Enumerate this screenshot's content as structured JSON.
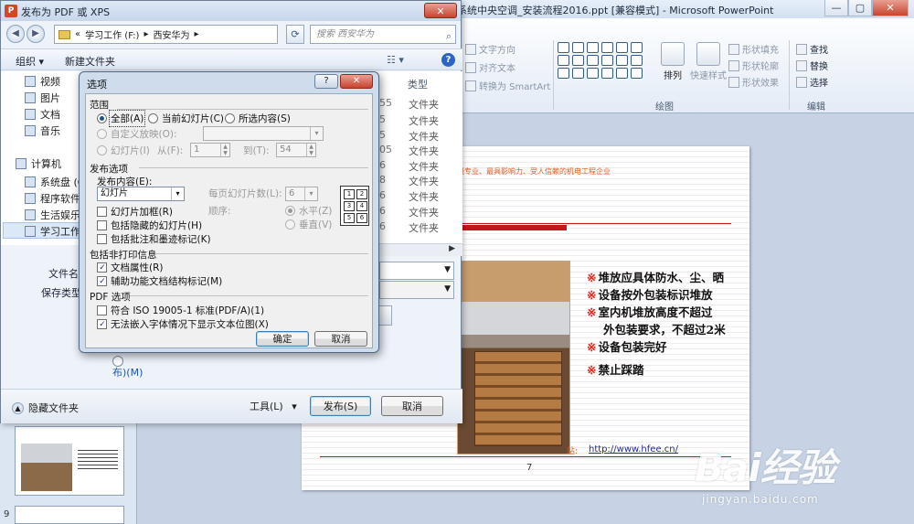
{
  "powerpoint": {
    "window_title": "系统中央空调_安装流程2016.ppt [兼容模式] - Microsoft PowerPoint",
    "ribbon": {
      "arrange_group": {
        "text_direction": "文字方向",
        "align_text": "对齐文本",
        "convert_smartart": "转换为 SmartArt"
      },
      "drawing_group": {
        "label": "绘图",
        "arrange": "排列",
        "quick_styles": "快速样式",
        "shape_fill": "形状填充",
        "shape_outline": "形状轮廓",
        "shape_effects": "形状效果"
      },
      "editing_group": {
        "label": "编辑",
        "find": "查找",
        "replace": "替换",
        "select": "选择"
      }
    },
    "thumbnails": [
      {
        "number": "9"
      }
    ],
    "slide": {
      "tagline": "最专业、最具影响力、受人信赖的机电工程企业",
      "bullets": [
        "堆放应具体防水、尘、晒",
        "设备按外包装标识堆放",
        "室内机堆放高度不超过",
        "设备包装完好",
        "禁止踩踏"
      ],
      "bullet_continuation": "外包装要求，不超过2米",
      "bullet_symbol": "※",
      "url_prefix": "站:",
      "url": "http://www.hfee.cn/",
      "page_number": "7"
    },
    "watermark": {
      "brand": "Bai经验",
      "site": "jingyan.baidu.com"
    }
  },
  "save_dialog": {
    "title": "发布为 PDF 或 XPS",
    "address": {
      "prefix": "«",
      "segments": [
        "学习工作 (F:)",
        "西安华为"
      ]
    },
    "search_placeholder": "搜索 西安华为",
    "toolbar": {
      "organize": "组织 ▾",
      "new_folder": "新建文件夹"
    },
    "nav_items": [
      "视频",
      "图片",
      "文档",
      "音乐",
      "计算机",
      "系统盘 (C:)",
      "程序软件",
      "生活娱乐",
      "学习工作"
    ],
    "file_list": {
      "type_header": "类型",
      "numbers": [
        "55",
        "5",
        "5",
        "05",
        "6",
        "8",
        "6",
        "6",
        "6"
      ],
      "types": [
        "文件夹",
        "文件夹",
        "文件夹",
        "文件夹",
        "文件夹",
        "文件夹",
        "文件夹",
        "文件夹",
        "文件夹"
      ]
    },
    "filename_label": "文件名",
    "savetype_label": "保存类型",
    "publish_option_link": "布)(M)",
    "hide_folders": "隐藏文件夹",
    "tools": "工具(L)",
    "publish": "发布(S)",
    "cancel": "取消"
  },
  "options_dialog": {
    "title": "选项",
    "help": "?",
    "range": {
      "label": "范围",
      "all": "全部(A)",
      "current_slide": "当前幻灯片(C)",
      "selection": "所选内容(S)",
      "custom_show": "自定义放映(O):",
      "slides": "幻灯片(I)",
      "from": "从(F):",
      "from_value": "1",
      "to": "到(T):",
      "to_value": "54"
    },
    "publish_options": {
      "label": "发布选项",
      "content_label": "发布内容(E):",
      "content_value": "幻灯片",
      "per_page_label": "每页幻灯片数(L):",
      "per_page_value": "6",
      "order_label": "顺序:",
      "horizontal": "水平(Z)",
      "vertical": "垂直(V)",
      "frame": "幻灯片加框(R)",
      "hidden": "包括隐藏的幻灯片(H)",
      "comments": "包括批注和墨迹标记(K)",
      "layout_icon_numbers": [
        "1",
        "2",
        "3",
        "4",
        "5",
        "6"
      ]
    },
    "non_print": {
      "label": "包括非打印信息",
      "doc_properties": "文档属性(R)",
      "accessibility_tags": "辅助功能文档结构标记(M)",
      "doc_properties_checked": true,
      "accessibility_tags_checked": true
    },
    "pdf_options": {
      "label": "PDF 选项",
      "iso": "符合 ISO 19005-1 标准(PDF/A)(1)",
      "bitmap": "无法嵌入字体情况下显示文本位图(X)",
      "iso_checked": false,
      "bitmap_checked": true
    },
    "ok": "确定",
    "cancel": "取消"
  }
}
